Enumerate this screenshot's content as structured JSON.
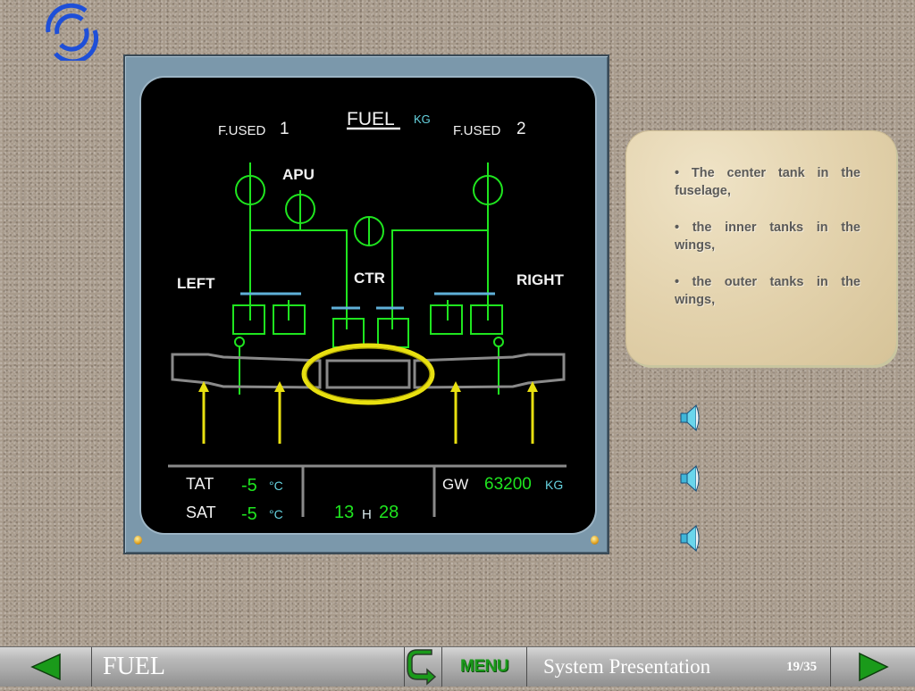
{
  "logo": {
    "icon": "airline-swirl-logo-icon",
    "color": "#1e4fd8"
  },
  "ecam": {
    "title": "FUEL",
    "title_unit": "KG",
    "fused_label_1": "F.USED",
    "fused_num_1": "1",
    "fused_label_2": "F.USED",
    "fused_num_2": "2",
    "labels": {
      "apu": "APU",
      "left": "LEFT",
      "ctr": "CTR",
      "right": "RIGHT"
    },
    "status": {
      "tat_label": "TAT",
      "tat_value": "-5",
      "tat_unit": "°C",
      "sat_label": "SAT",
      "sat_value": "-5",
      "sat_unit": "°C",
      "time_hours": "13",
      "time_sep": "H",
      "time_minutes": "28",
      "gw_label": "GW",
      "gw_value": "63200",
      "gw_unit": "KG"
    },
    "colors": {
      "line": "#1fe51f",
      "valve": "#5fb0d8",
      "tank": "#8a8a8a",
      "highlight": "#e8e010",
      "arrow": "#e8e010"
    }
  },
  "info_card": {
    "bullets": [
      "• The center tank in the fuselage,",
      "• the inner tanks in the wings,",
      "• the outer tanks in the wings,"
    ]
  },
  "audio": {
    "icons": [
      "speaker-icon",
      "speaker-icon",
      "speaker-icon"
    ]
  },
  "bottom_bar": {
    "prev_icon": "triangle-left-icon",
    "section_title": "FUEL",
    "return_icon": "return-arrow-icon",
    "menu_label": "MENU",
    "subtitle": "System Presentation",
    "page_indicator": "19/35",
    "next_icon": "triangle-right-icon"
  }
}
